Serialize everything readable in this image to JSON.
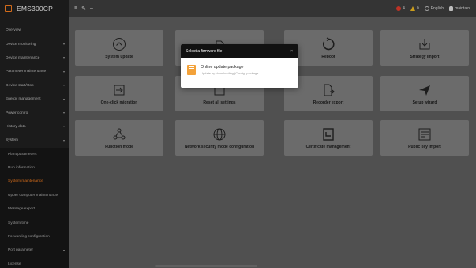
{
  "app": {
    "title": "EMS300CP"
  },
  "topbar": {
    "alarm_count": "4",
    "warning_count": "0",
    "language": "English",
    "user": "maintain"
  },
  "sidebar": {
    "items": [
      {
        "label": "Overview",
        "chevron": false
      },
      {
        "label": "Device monitoring",
        "chevron": true
      },
      {
        "label": "Device maintenance",
        "chevron": true
      },
      {
        "label": "Parameter maintenance",
        "chevron": true
      },
      {
        "label": "Device start/stop",
        "chevron": true
      },
      {
        "label": "Energy management",
        "chevron": true
      },
      {
        "label": "Power control",
        "chevron": true
      },
      {
        "label": "History data",
        "chevron": true
      },
      {
        "label": "System",
        "chevron": true
      }
    ],
    "sub_items": [
      {
        "label": "Plant parameters"
      },
      {
        "label": "Run information"
      },
      {
        "label": "System maintenance",
        "active": true
      },
      {
        "label": "Upper computer maintenance"
      },
      {
        "label": "Message export"
      },
      {
        "label": "System time"
      },
      {
        "label": "Forwarding configuration"
      },
      {
        "label": "Port parameter",
        "chevron": true
      },
      {
        "label": "License"
      }
    ]
  },
  "content": {
    "cards": [
      {
        "label": "System update",
        "icon": "upload-circle-icon"
      },
      {
        "label": "",
        "icon": "file-icon"
      },
      {
        "label": "Reboot",
        "icon": "reboot-icon"
      },
      {
        "label": "Strategy import",
        "icon": "import-icon"
      },
      {
        "label": "One-click migration",
        "icon": "migration-icon"
      },
      {
        "label": "Reset all settings",
        "icon": "reset-icon"
      },
      {
        "label": "Recorder export",
        "icon": "export-icon"
      },
      {
        "label": "Setup wizard",
        "icon": "wizard-icon"
      },
      {
        "label": "Function mode",
        "icon": "function-mode-icon"
      },
      {
        "label": "Network security mode configuration",
        "icon": "globe-icon"
      },
      {
        "label": "Certificate management",
        "icon": "certificate-icon"
      },
      {
        "label": "Public key import",
        "icon": "key-import-icon"
      }
    ]
  },
  "modal": {
    "title": "Select a firmware file",
    "close": "×",
    "options": [
      {
        "title": "Online update package",
        "desc": "Update by downloading (Config) package",
        "icon": "package-icon"
      }
    ]
  }
}
